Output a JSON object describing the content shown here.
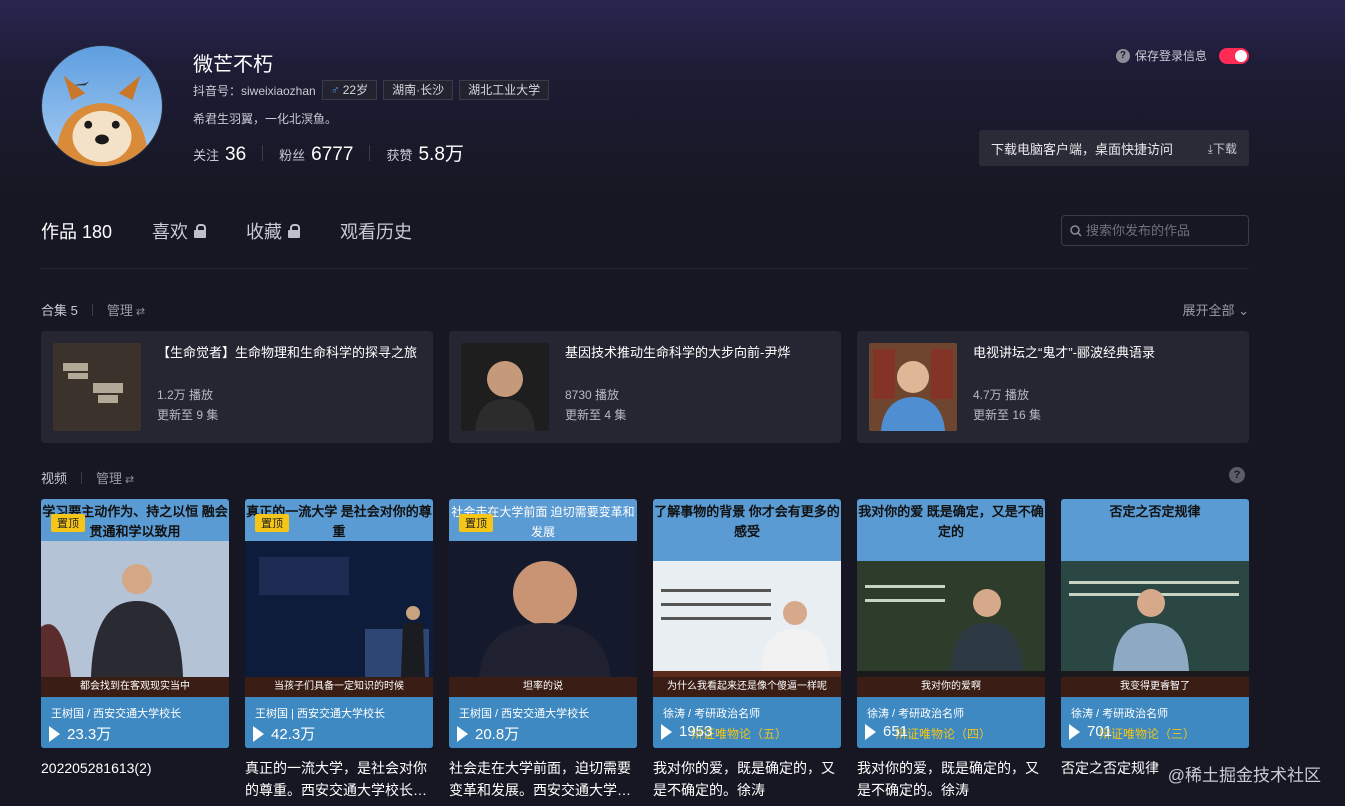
{
  "profile": {
    "nickname": "微芒不朽",
    "douyin_id": "抖音号：siweixiaozhan",
    "age": "22岁",
    "location": "湖南·长沙",
    "school": "湖北工业大学",
    "bio": "希君生羽翼，一化北溟鱼。",
    "following_label": "关注",
    "following": "36",
    "followers_label": "粉丝",
    "followers": "6777",
    "likes_label": "获赞",
    "likes": "5.8万"
  },
  "header": {
    "save_login": "保存登录信息",
    "download_text": "下载电脑客户端，桌面快捷访问",
    "download_btn": "下载"
  },
  "tabs": [
    {
      "label": "作品 180"
    },
    {
      "label": "喜欢"
    },
    {
      "label": "收藏"
    },
    {
      "label": "观看历史"
    }
  ],
  "search": {
    "placeholder": "搜索你发布的作品"
  },
  "collections_section": {
    "title": "合集 5",
    "manage": "管理",
    "expand": "展开全部"
  },
  "collections": [
    {
      "title": "【生命觉者】生命物理和生命科学的探寻之旅",
      "plays": "1.2万 播放",
      "updates": "更新至 9 集"
    },
    {
      "title": "基因技术推动生命科学的大步向前-尹烨",
      "plays": "8730 播放",
      "updates": "更新至 4 集"
    },
    {
      "title": "电视讲坛之“鬼才”-郦波经典语录",
      "plays": "4.7万 播放",
      "updates": "更新至 16 集"
    }
  ],
  "videos_section": {
    "title": "视频",
    "manage": "管理"
  },
  "videos": [
    {
      "pin": "置顶",
      "headline": "学习要主动作为、持之以恒 融会贯通和学以致用",
      "caption": "都会找到在客观现实当中",
      "author": "王树国 / 西安交通大学校长",
      "likes": "23.3万",
      "series": "",
      "desc": "202205281613(2)"
    },
    {
      "pin": "置顶",
      "headline": "真正的一流大学 是社会对你的尊重",
      "caption": "当孩子们具备一定知识的时候",
      "author": "王树国 | 西安交通大学校长",
      "likes": "42.3万",
      "series": "",
      "desc": "真正的一流大学，是社会对你的尊重。西安交通大学校长…"
    },
    {
      "pin": "置顶",
      "headline": "社会走在大学前面 迫切需要变革和发展",
      "caption": "坦率的说",
      "author": "王树国 / 西安交通大学校长",
      "likes": "20.8万",
      "series": "",
      "desc": "社会走在大学前面，迫切需要变革和发展。西安交通大学…"
    },
    {
      "pin": "",
      "headline": "了解事物的背景 你才会有更多的感受",
      "caption": "为什么我看起来还是像个傻逼一样呢",
      "author": "徐涛 / 考研政治名师",
      "likes": "1953",
      "series": "辩证唯物论（五）",
      "desc": "我对你的爱，既是确定的，又是不确定的。徐涛"
    },
    {
      "pin": "",
      "headline": "我对你的爱 既是确定，又是不确定的",
      "caption": "我对你的爱啊",
      "author": "徐涛 / 考研政治名师",
      "likes": "651",
      "series": "辩证唯物论（四）",
      "desc": "我对你的爱，既是确定的，又是不确定的。徐涛"
    },
    {
      "pin": "",
      "headline": "否定之否定规律",
      "caption": "我变得更睿智了",
      "author": "徐涛 / 考研政治名师",
      "likes": "701",
      "series": "辩证唯物论（三）",
      "desc": "否定之否定规律"
    }
  ],
  "watermark": "@稀土掘金技术社区"
}
